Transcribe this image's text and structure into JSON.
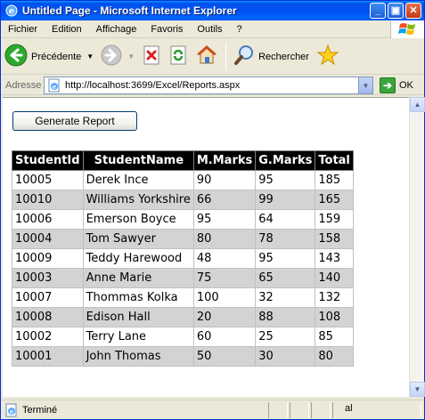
{
  "window": {
    "title": "Untitled Page - Microsoft Internet Explorer",
    "buttons": {
      "minimize": "_",
      "maximize": "▣",
      "close": "✕"
    }
  },
  "menubar": {
    "items": [
      {
        "label": "Fichier"
      },
      {
        "label": "Edition"
      },
      {
        "label": "Affichage"
      },
      {
        "label": "Favoris"
      },
      {
        "label": "Outils"
      },
      {
        "label": "?"
      }
    ]
  },
  "toolbar": {
    "back_label": "Précédente",
    "search_label": "Rechercher",
    "icons": [
      "back-arrow-icon",
      "forward-arrow-icon",
      "stop-icon",
      "refresh-icon",
      "home-icon",
      "search-icon",
      "favorites-star-icon"
    ]
  },
  "address": {
    "label": "Adresse",
    "url": "http://localhost:3699/Excel/Reports.aspx",
    "go_label": "OK"
  },
  "page": {
    "button_label": "Generate Report",
    "table": {
      "headers": [
        "StudentId",
        "StudentName",
        "M.Marks",
        "G.Marks",
        "Total"
      ],
      "rows": [
        [
          "10005",
          "Derek Ince",
          "90",
          "95",
          "185"
        ],
        [
          "10010",
          "Williams Yorkshire",
          "66",
          "99",
          "165"
        ],
        [
          "10006",
          "Emerson Boyce",
          "95",
          "64",
          "159"
        ],
        [
          "10004",
          "Tom Sawyer",
          "80",
          "78",
          "158"
        ],
        [
          "10009",
          "Teddy Harewood",
          "48",
          "95",
          "143"
        ],
        [
          "10003",
          "Anne Marie",
          "75",
          "65",
          "140"
        ],
        [
          "10007",
          "Thommas Kolka",
          "100",
          "32",
          "132"
        ],
        [
          "10008",
          "Edison Hall",
          "20",
          "88",
          "108"
        ],
        [
          "10002",
          "Terry Lane",
          "60",
          "25",
          "85"
        ],
        [
          "10001",
          "John Thomas",
          "50",
          "30",
          "80"
        ]
      ]
    }
  },
  "statusbar": {
    "text": "Terminé",
    "zone": "al"
  },
  "colors": {
    "title_blue": "#0053ee",
    "header_bg": "#000000",
    "alt_row": "#d3d3d3"
  }
}
